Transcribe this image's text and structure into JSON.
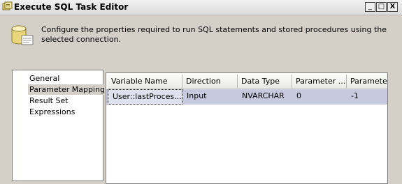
{
  "window": {
    "title": "Execute SQL Task Editor",
    "icon": "package-task-icon",
    "controls": {
      "minimize": "_",
      "maximize": "□",
      "close": "X"
    }
  },
  "header": {
    "icon": "database-scroll-icon",
    "description": "Configure the properties required to run SQL statements and stored procedures using the selected connection."
  },
  "nav": {
    "items": [
      {
        "label": "General",
        "selected": false
      },
      {
        "label": "Parameter Mapping",
        "selected": true
      },
      {
        "label": "Result Set",
        "selected": false
      },
      {
        "label": "Expressions",
        "selected": false
      }
    ]
  },
  "grid": {
    "columns": [
      "Variable Name",
      "Direction",
      "Data Type",
      "Parameter ...",
      "Parameter Size"
    ],
    "rows": [
      {
        "variable_name": "User::lastProces...",
        "direction": "Input",
        "data_type": "NVARCHAR",
        "parameter_name": "0",
        "parameter_size": "-1"
      }
    ],
    "selection_color": "#c7cadf"
  }
}
